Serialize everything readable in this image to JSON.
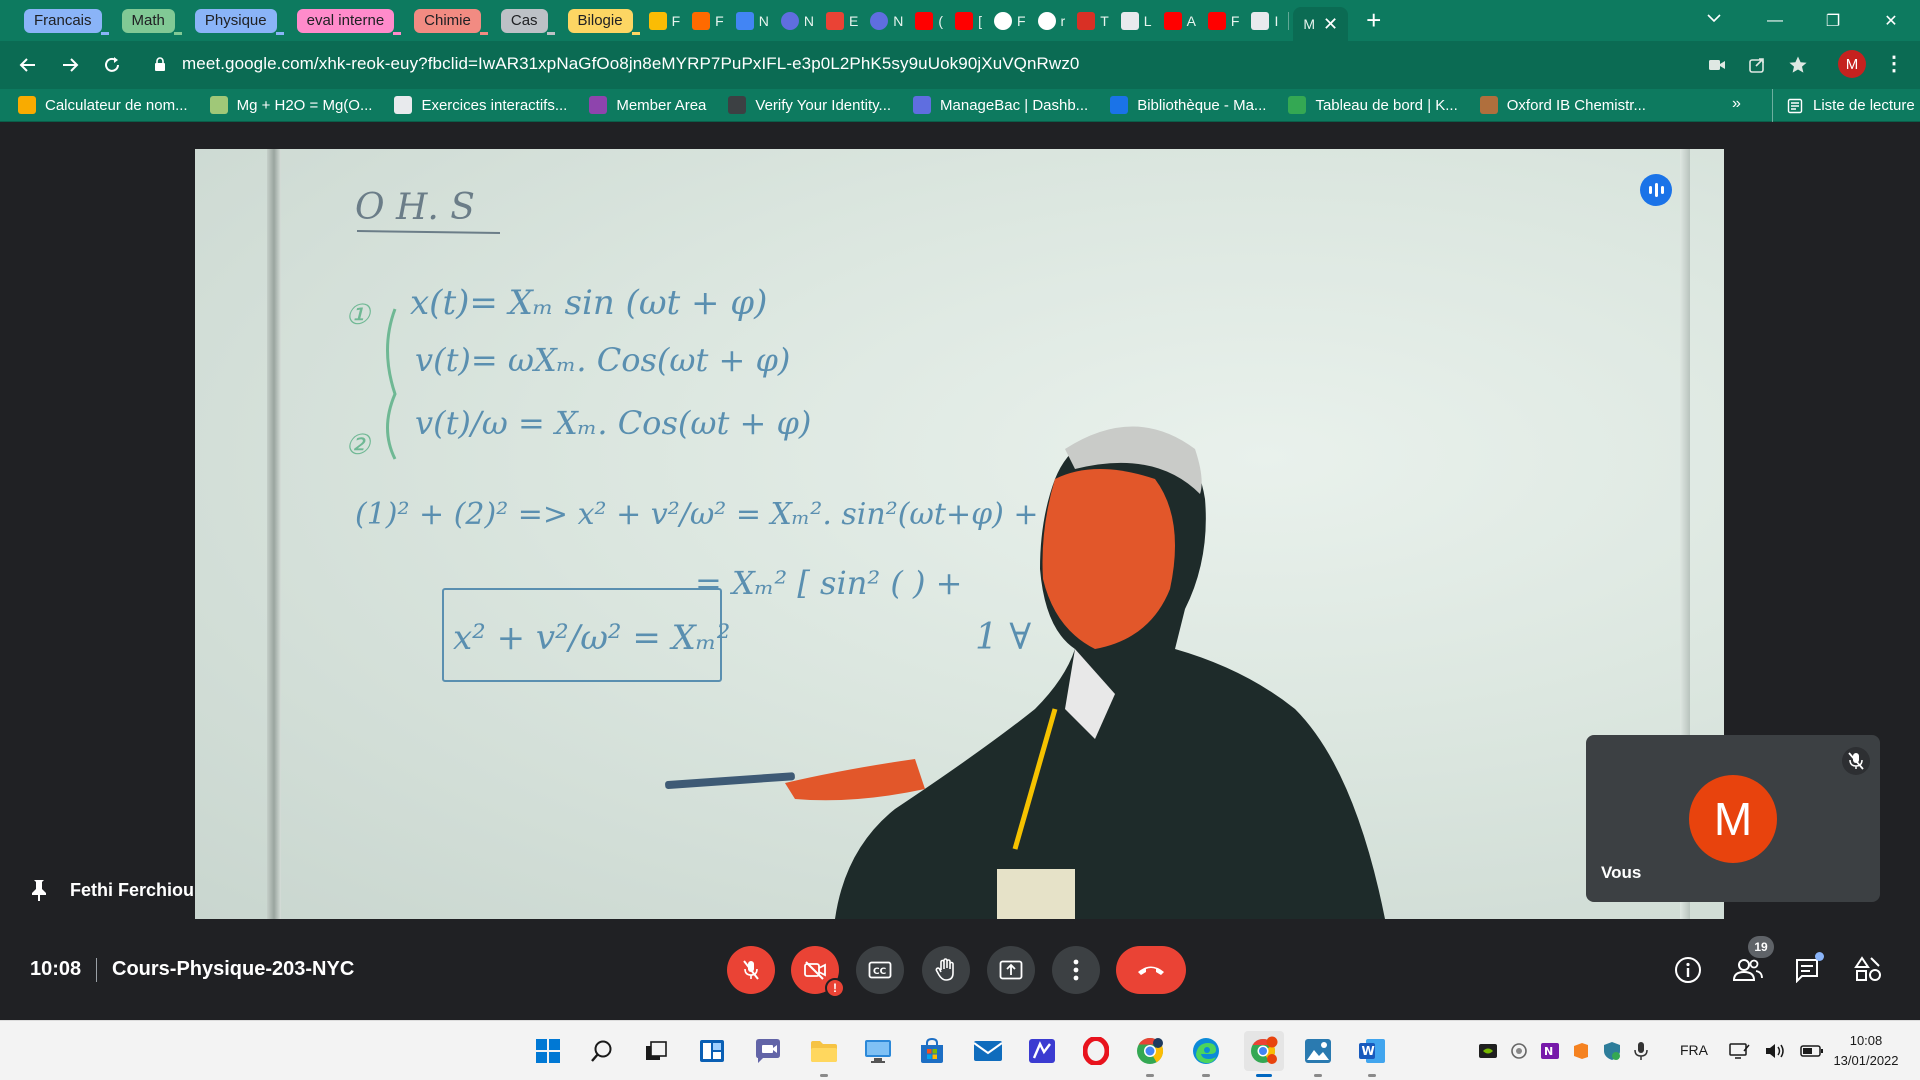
{
  "browser": {
    "tab_groups": [
      {
        "label": "Francais",
        "color": "#8ab4f8"
      },
      {
        "label": "Math",
        "color": "#81c995"
      },
      {
        "label": "Physique",
        "color": "#8ab4f8"
      },
      {
        "label": "eval interne",
        "color": "#ff8bcb"
      },
      {
        "label": "Chimie",
        "color": "#f28b82"
      },
      {
        "label": "Cas",
        "color": "#bdc1c6"
      },
      {
        "label": "Bilogie",
        "color": "#fdd663"
      }
    ],
    "pinned_tabs": [
      {
        "icon": "drive-icon",
        "letter": "F"
      },
      {
        "icon": "fk-icon",
        "letter": "F"
      },
      {
        "icon": "docs-icon",
        "letter": "N"
      },
      {
        "icon": "managebac-icon",
        "letter": "N"
      },
      {
        "icon": "gmail-icon",
        "letter": "E"
      },
      {
        "icon": "managebac-icon",
        "letter": "N"
      },
      {
        "icon": "youtube-icon",
        "letter": "("
      },
      {
        "icon": "youtube-icon",
        "letter": "["
      },
      {
        "icon": "google-icon",
        "letter": "F"
      },
      {
        "icon": "globe-icon",
        "letter": "r"
      },
      {
        "icon": "toolbox-icon",
        "letter": "T"
      },
      {
        "icon": "page-icon",
        "letter": "L"
      },
      {
        "icon": "youtube-icon",
        "letter": "A"
      },
      {
        "icon": "youtube-icon",
        "letter": "F"
      },
      {
        "icon": "page-icon",
        "letter": "I"
      }
    ],
    "active_tab": {
      "letter": "M",
      "close": "✕"
    },
    "new_tab": "+",
    "url": "meet.google.com/xhk-reok-euy?fbclid=IwAR31xpNaGfOo8jn8eMYRP7PuPxIFL-e3p0L2PhK5sy9uUok90jXuVQnRwz0",
    "profile_letter": "M",
    "window_controls": {
      "minimize": "—",
      "restore": "❐",
      "close": "✕"
    },
    "bookmarks": [
      {
        "label": "Calculateur de nom...",
        "icon_color": "#f9ab00"
      },
      {
        "label": "Mg + H2O = Mg(O...",
        "icon_color": "#a0c878"
      },
      {
        "label": "Exercices interactifs...",
        "icon_color": "#e8eaed"
      },
      {
        "label": "Member Area",
        "icon_color": "#8e44ad"
      },
      {
        "label": "Verify Your Identity...",
        "icon_color": "#3c4043"
      },
      {
        "label": "ManageBac | Dashb...",
        "icon_color": "#5f6ee0"
      },
      {
        "label": "Bibliothèque - Ma...",
        "icon_color": "#1a73e8"
      },
      {
        "label": "Tableau de bord | K...",
        "icon_color": "#34a853"
      },
      {
        "label": "Oxford IB Chemistr...",
        "icon_color": "#b06f3d"
      }
    ],
    "bookmarks_more": "»",
    "reading_list": "Liste de lecture",
    "theme": {
      "tabstrip": "#0d7a5f",
      "toolbar": "#0b6b53"
    }
  },
  "meet": {
    "speaker_name": "Fethi Ferchiou",
    "self_label": "Vous",
    "self_initial": "M",
    "self_avatar_color": "#e8430d",
    "time": "10:08",
    "meeting_code": "Cours-Physique-203-NYC",
    "participant_count": "19",
    "warning_badge": "!",
    "whiteboard": {
      "title": "O H. S",
      "line1": "x(t)= Xₘ sin (ωt + φ)",
      "line2": "v(t)= ωXₘ. Cos(ωt + φ)",
      "line3": "v(t)/ω = Xₘ. Cos(ωt + φ)",
      "line4": "(1)² + (2)² => x² + v²/ω² = Xₘ². sin²(ωt+φ) + Xₘ²",
      "line5": "= Xₘ² [ sin² ( ) +",
      "line6": "1 ∀",
      "boxed": "x² + v²/ω² = Xₘ²",
      "marker1": "①",
      "marker2": "②"
    }
  },
  "taskbar": {
    "language": "FRA",
    "clock_time": "10:08",
    "clock_date": "13/01/2022"
  }
}
